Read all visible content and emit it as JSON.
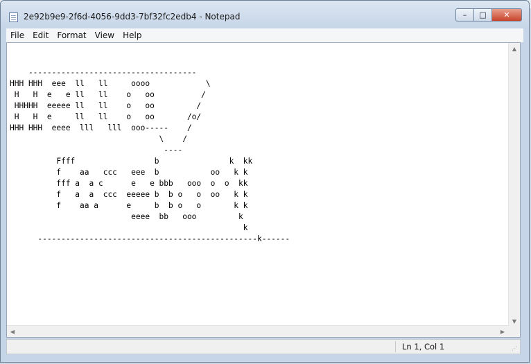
{
  "window": {
    "title": "2e92b9e9-2f6d-4056-9dd3-7bf32fc2edb4 - Notepad",
    "controls": {
      "minimize": "–",
      "maximize": "□",
      "close": "✕"
    }
  },
  "menubar": {
    "items": [
      "File",
      "Edit",
      "Format",
      "View",
      "Help"
    ]
  },
  "editor": {
    "text": "\n\n    ------------------------------------\nHHH HHH  eee  ll   ll     oooo            \\\n H   H  e   e ll   ll    o   oo          /\n HHHHH  eeeee ll   ll    o   oo         /\n H   H  e     ll   ll    o   oo       /o/\nHHH HHH  eeee  lll   lll  ooo-----    /\n                                \\    /\n                                 ----\n          Ffff                 b               k  kk\n          f    aa   ccc   eee  b           oo   k k\n          fff a  a c      e   e bbb   ooo  o  o  kk\n          f   a  a  ccc  eeeee b  b o   o  oo   k k\n          f    aa a      e     b  b o   o       k k\n                          eeee  bb   ooo         k\n                                                  k\n      -----------------------------------------------k------"
  },
  "statusbar": {
    "position": "Ln 1, Col 1"
  },
  "icons": {
    "scroll_up": "▲",
    "scroll_down": "▼",
    "scroll_left": "◀",
    "scroll_right": "▶"
  }
}
